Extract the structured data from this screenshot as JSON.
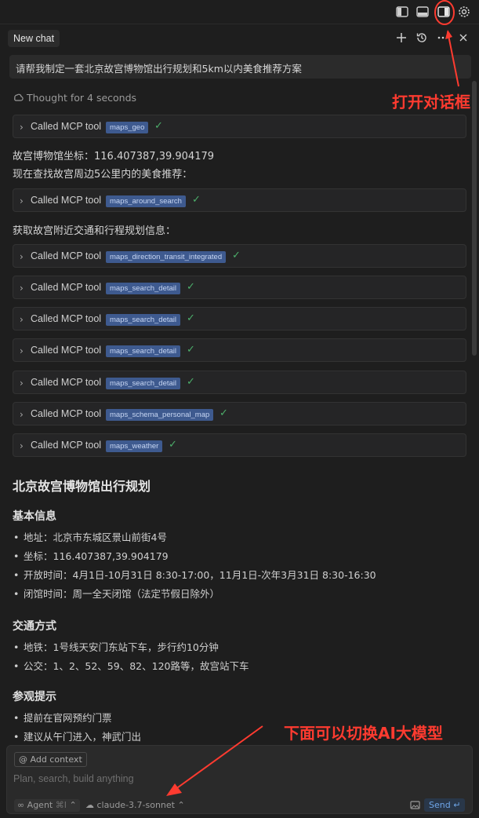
{
  "header": {
    "tab_label": "New chat",
    "icons": [
      "layout-sidebar-left-icon",
      "layout-panel-bottom-icon",
      "layout-sidebar-right-icon",
      "gear-icon",
      "plus-icon",
      "history-icon",
      "more-icon",
      "close-icon"
    ]
  },
  "user_message": "请帮我制定一套北京故宫博物馆出行规划和5km以内美食推荐方案",
  "thought": "Thought for 4 seconds",
  "tool_label": "Called MCP tool",
  "tools_group1": [
    {
      "name": "maps_geo"
    }
  ],
  "text1": "故宫博物馆坐标：116.407387,39.904179",
  "text2": "现在查找故宫周边5公里内的美食推荐：",
  "tools_group2": [
    {
      "name": "maps_around_search"
    }
  ],
  "text3": "获取故宫附近交通和行程规划信息：",
  "tools_group3": [
    {
      "name": "maps_direction_transit_integrated"
    },
    {
      "name": "maps_search_detail"
    },
    {
      "name": "maps_search_detail"
    },
    {
      "name": "maps_search_detail"
    },
    {
      "name": "maps_search_detail"
    },
    {
      "name": "maps_schema_personal_map"
    },
    {
      "name": "maps_weather"
    }
  ],
  "plan": {
    "title": "北京故宫博物馆出行规划",
    "basic_title": "基本信息",
    "basic_items": [
      "地址：北京市东城区景山前街4号",
      "坐标：116.407387,39.904179",
      "开放时间：4月1日-10月31日 8:30-17:00，11月1日-次年3月31日 8:30-16:30",
      "闭馆时间：周一全天闭馆（法定节假日除外）"
    ],
    "transport_title": "交通方式",
    "transport_items": [
      "地铁：1号线天安门东站下车，步行约10分钟",
      "公交：1、2、52、59、82、120路等，故宫站下车"
    ],
    "tips_title": "参观提示",
    "tips_items": [
      "提前在官网预约门票",
      "建议从午门进入，神武门出"
    ]
  },
  "composer": {
    "add_context": "Add context",
    "placeholder": "Plan, search, build anything",
    "agent_label": "Agent",
    "agent_shortcut": "⌘I",
    "model": "claude-3.7-sonnet",
    "send_label": "Send"
  },
  "annotations": {
    "top": "打开对话框",
    "bottom": "下面可以切换AI大模型",
    "color": "#ff3b30"
  }
}
